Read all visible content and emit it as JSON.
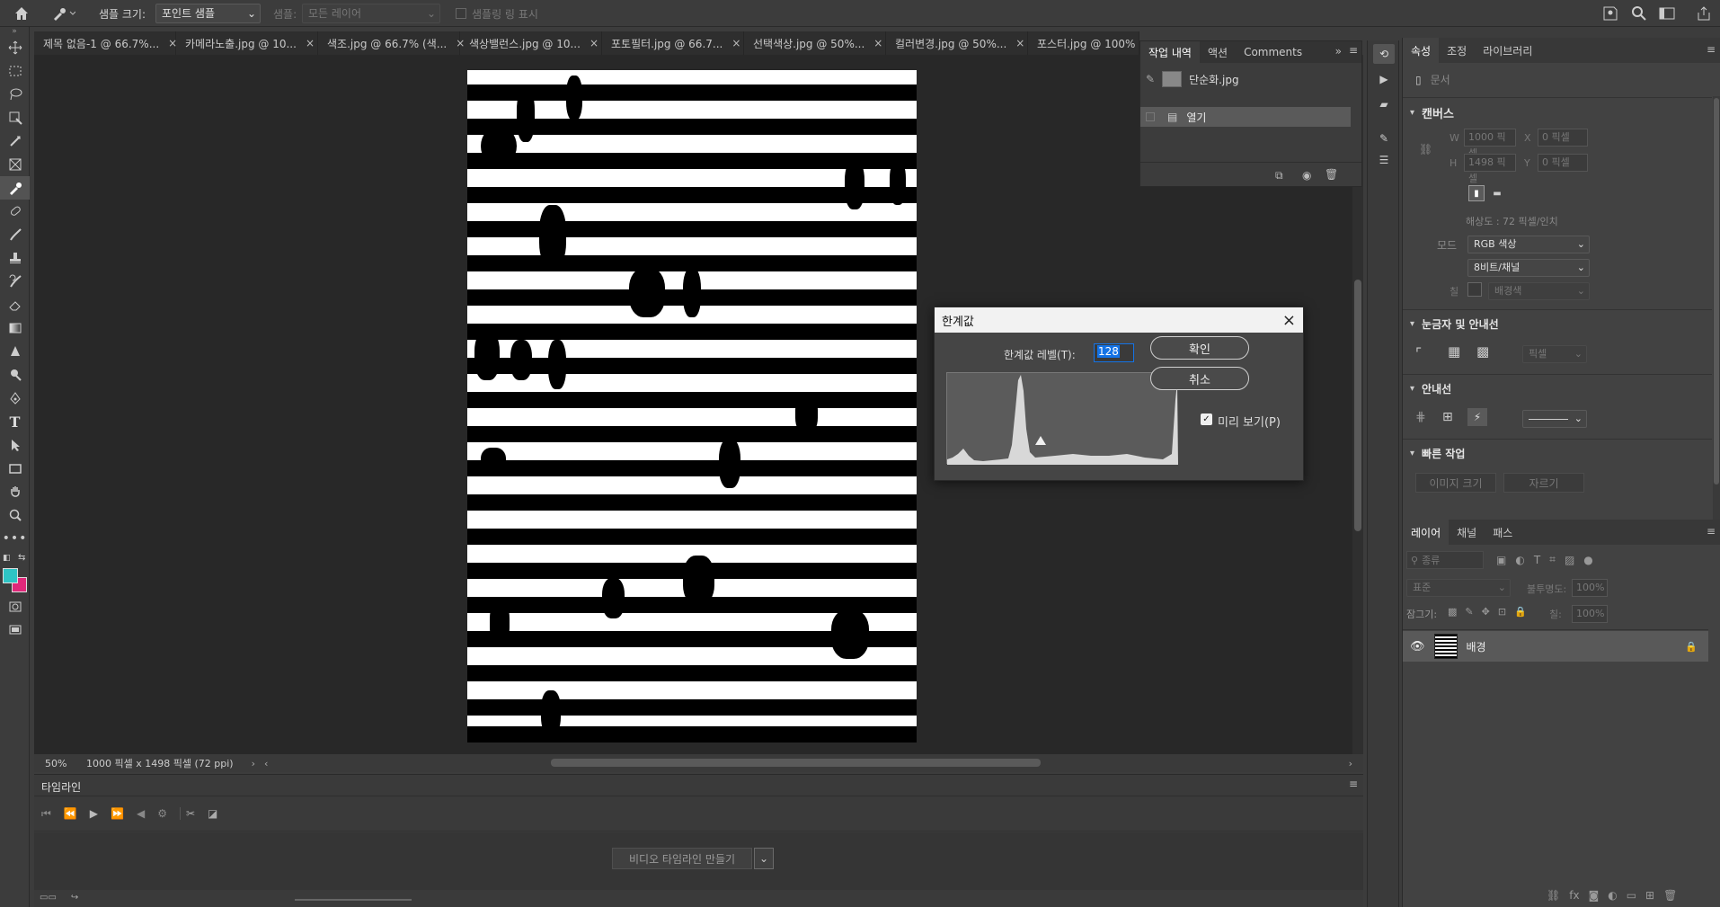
{
  "options_bar": {
    "sample_size_label": "샘플 크기:",
    "sample_size_value": "포인트 샘플",
    "sample_label": "샘플:",
    "sample_value": "모든 레이어",
    "show_ring_label": "샘플링 링 표시"
  },
  "doc_tabs": [
    {
      "label": "제목 없음-1 @ 66.7%..."
    },
    {
      "label": "카메라노출.jpg @ 10..."
    },
    {
      "label": "색조.jpg @ 66.7% (색..."
    },
    {
      "label": "색상밸런스.jpg @ 10..."
    },
    {
      "label": "포토필터.jpg @ 66.7..."
    },
    {
      "label": "선택색상.jpg @ 50%..."
    },
    {
      "label": "컬러변경.jpg @ 50%..."
    },
    {
      "label": "포스터.jpg @ 100% (..."
    }
  ],
  "history_panel": {
    "tabs": [
      "작업 내역",
      "액션",
      "Comments"
    ],
    "items": [
      {
        "label": "단순화.jpg"
      },
      {
        "label": "열기"
      }
    ]
  },
  "status_bar": {
    "zoom": "50%",
    "doc_info": "1000 픽셀 x 1498 픽셀 (72 ppi)"
  },
  "timeline": {
    "title": "타임라인",
    "create_video_label": "비디오 타임라인 만들기"
  },
  "threshold_dialog": {
    "title": "한계값",
    "level_label": "한계값 레벨(T):",
    "level_value": "128",
    "ok_label": "확인",
    "cancel_label": "취소",
    "preview_label": "미리 보기(P)",
    "preview_checked": true
  },
  "properties_panel": {
    "tabs": [
      "속성",
      "조정",
      "라이브러리"
    ],
    "doc_label": "문서",
    "canvas_section": "캔버스",
    "w_label": "W",
    "w_value": "1000 픽셀",
    "h_label": "H",
    "h_value": "1498 픽셀",
    "x_label": "X",
    "x_value": "0 픽셀",
    "y_label": "Y",
    "y_value": "0 픽셀",
    "resolution": "해상도 : 72 픽셀/인치",
    "mode_label": "모드",
    "mode_value": "RGB 색상",
    "depth_value": "8비트/채널",
    "fill_label": "칠",
    "fill_value": "배경색",
    "rulers_section": "눈금자 및 안내선",
    "ruler_unit": "픽셀",
    "guides_section": "안내선",
    "quick_actions_section": "빠른 작업",
    "quick_action_1": "이미지 크기",
    "quick_action_2": "자르기"
  },
  "layers_panel": {
    "tabs": [
      "레이어",
      "채널",
      "패스"
    ],
    "filter_label": "종류",
    "blend_mode": "표준",
    "opacity_label": "불투명도:",
    "opacity_value": "100%",
    "lock_label": "잠그기:",
    "fill_label": "칠:",
    "fill_value": "100%",
    "layers": [
      {
        "name": "배경"
      }
    ]
  },
  "colors": {
    "foreground": "#2ec4c4",
    "background": "#e0287a",
    "accent": "#1473e6"
  }
}
